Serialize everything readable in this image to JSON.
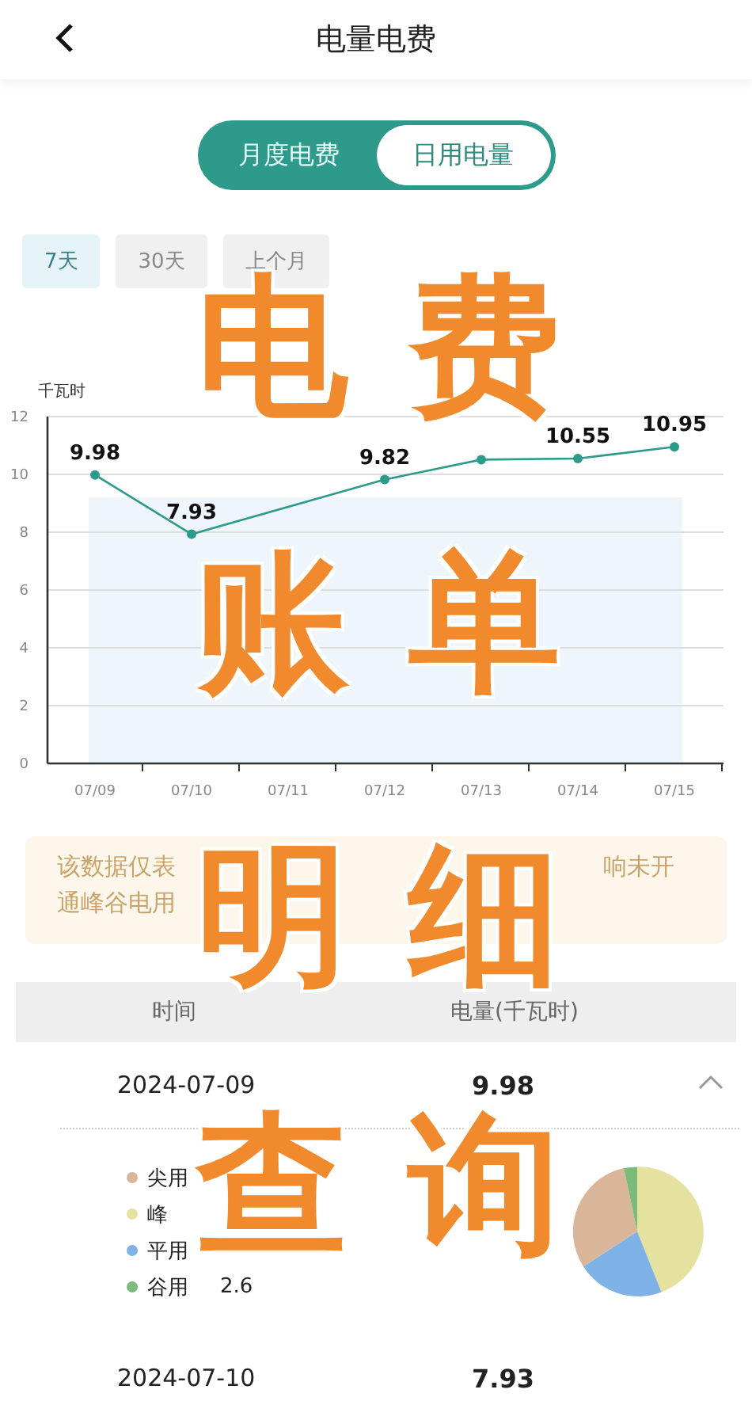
{
  "header": {
    "title": "电量电费"
  },
  "view_tabs": [
    {
      "label": "月度电费",
      "selected": false
    },
    {
      "label": "日用电量",
      "selected": true
    }
  ],
  "period_tabs": [
    {
      "label": "7天",
      "selected": true
    },
    {
      "label": "30天",
      "selected": false
    },
    {
      "label": "上个月",
      "selected": false
    }
  ],
  "chart": {
    "unit_label": "千瓦时",
    "chart_data": {
      "type": "line",
      "categories": [
        "07/09",
        "07/10",
        "07/11",
        "07/12",
        "07/13",
        "07/14",
        "07/15"
      ],
      "series": [
        {
          "color": "#2e9a8c",
          "values": [
            9.98,
            7.93,
            null,
            9.82,
            10.51,
            10.55,
            10.95
          ],
          "marker": true
        }
      ],
      "grid": true,
      "ylim": [
        0,
        12
      ],
      "yticks": [
        0,
        2,
        4,
        6,
        8,
        10,
        12
      ],
      "value_labels": [
        "9.98",
        "7.93",
        null,
        "9.82",
        null,
        "10.55",
        "10.95"
      ]
    }
  },
  "notice": {
    "lines": [
      [
        "该数据仅表",
        "响未开"
      ],
      [
        "通峰谷电用"
      ]
    ]
  },
  "table": {
    "columns": [
      "时间",
      "电量(千瓦时)"
    ],
    "rows": [
      {
        "date": "2024-07-09",
        "value": "9.98",
        "expanded": true,
        "legend": [
          {
            "label": "尖用",
            "color": "#d9b59a"
          },
          {
            "label": "峰",
            "color": "#e5e2a0"
          },
          {
            "label": "平用",
            "color": "#7fb3e8"
          },
          {
            "label": "谷用",
            "value": "2.6",
            "color": "#7dbb7d"
          }
        ]
      },
      {
        "date": "2024-07-10",
        "value": "7.93"
      }
    ]
  },
  "overlay_title": [
    "电费",
    "账单",
    "明细",
    "查询"
  ]
}
